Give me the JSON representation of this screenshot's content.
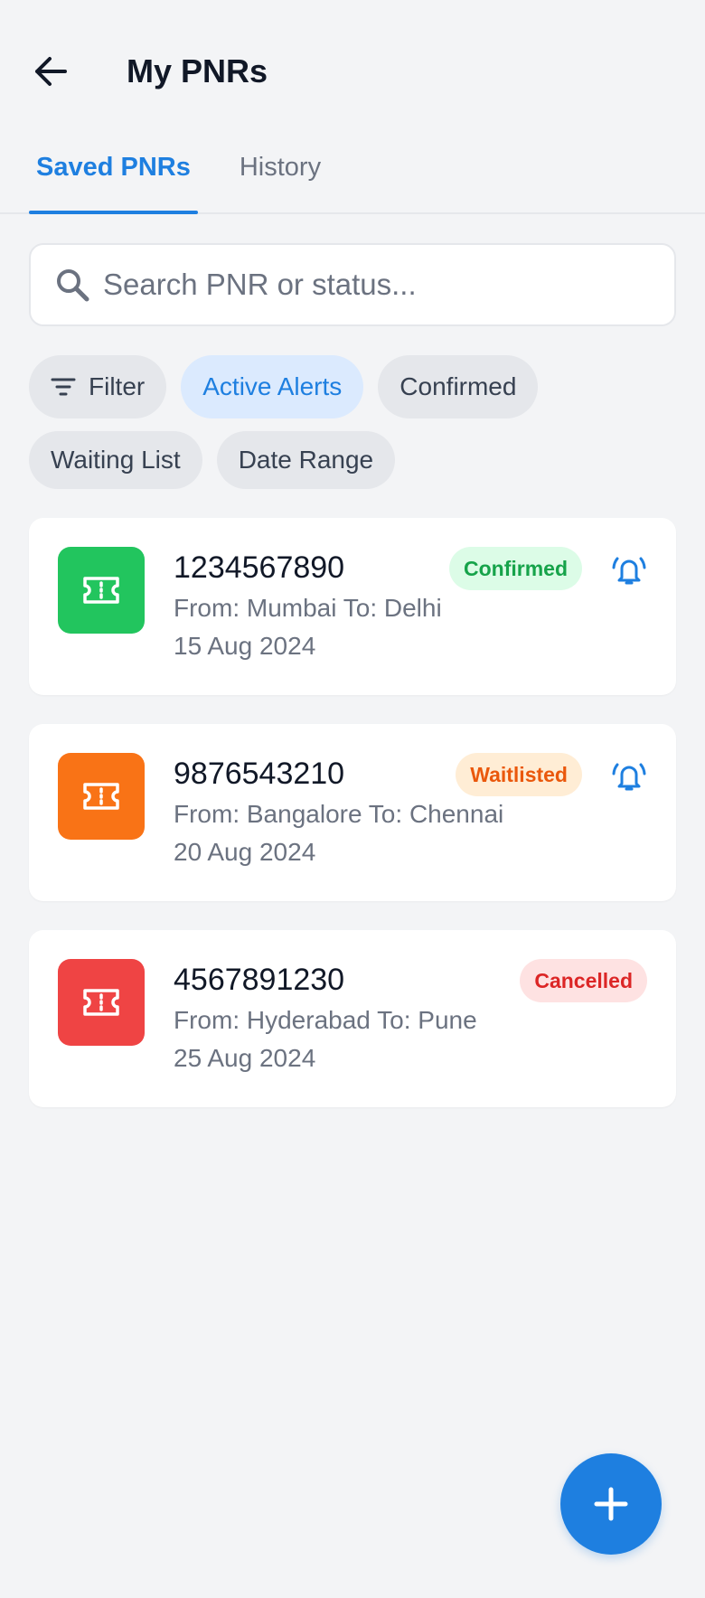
{
  "header": {
    "title": "My PNRs"
  },
  "tabs": [
    {
      "label": "Saved PNRs",
      "active": true
    },
    {
      "label": "History",
      "active": false
    }
  ],
  "search": {
    "placeholder": "Search PNR or status...",
    "value": ""
  },
  "filters": [
    {
      "label": "Filter",
      "icon": "filter-icon",
      "active": false
    },
    {
      "label": "Active Alerts",
      "active": true
    },
    {
      "label": "Confirmed",
      "active": false
    },
    {
      "label": "Waiting List",
      "active": false
    },
    {
      "label": "Date Range",
      "active": false
    }
  ],
  "pnrs": [
    {
      "number": "1234567890",
      "route": "From: Mumbai To: Delhi",
      "date": "15 Aug 2024",
      "status": "Confirmed",
      "color": "#22c55e",
      "badge_bg": "#dcfce7",
      "badge_fg": "#16a34a",
      "alert": true,
      "icon": "ticket-icon"
    },
    {
      "number": "9876543210",
      "route": "From: Bangalore To: Chennai",
      "date": "20 Aug 2024",
      "status": "Waitlisted",
      "color": "#f97316",
      "badge_bg": "#ffedd5",
      "badge_fg": "#ea580c",
      "alert": true,
      "icon": "ticket-icon"
    },
    {
      "number": "4567891230",
      "route": "From: Hyderabad To: Pune",
      "date": "25 Aug 2024",
      "status": "Cancelled",
      "color": "#ef4444",
      "badge_bg": "#fee2e2",
      "badge_fg": "#dc2626",
      "alert": false,
      "icon": "ticket-icon"
    }
  ],
  "accent": "#1e7fe0",
  "fab": {
    "icon": "plus-icon"
  }
}
